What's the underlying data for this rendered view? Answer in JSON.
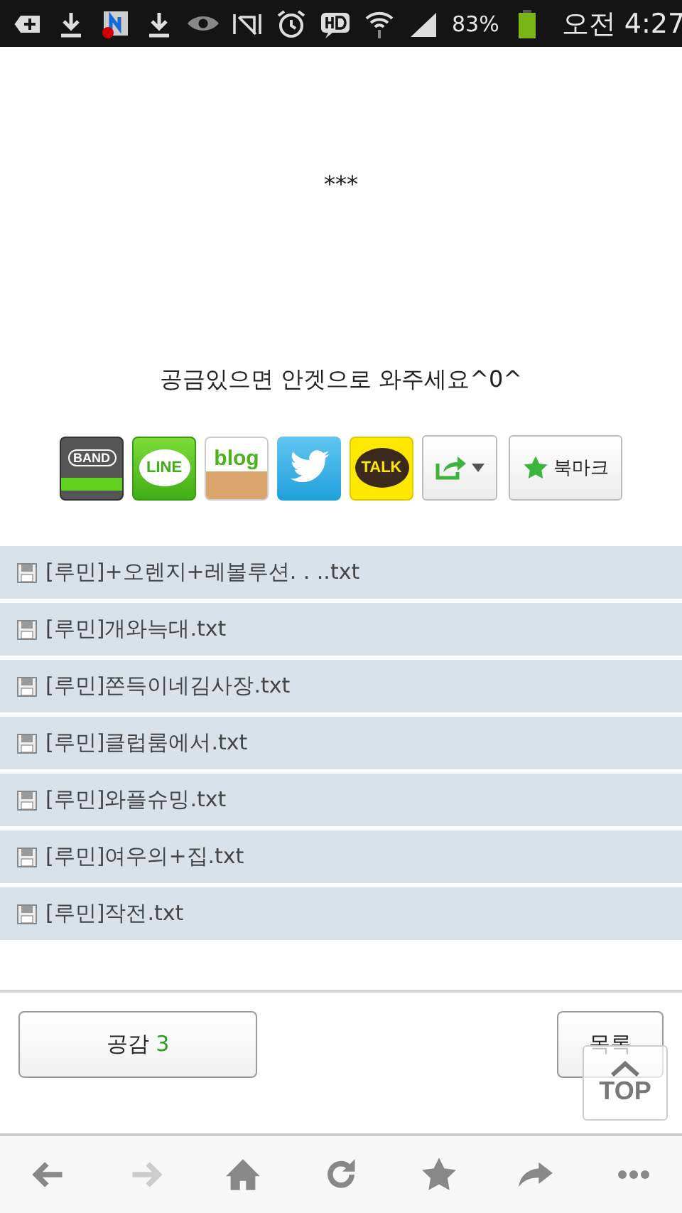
{
  "status_bar": {
    "battery_percent": "83%",
    "time": "오전 4:27"
  },
  "post": {
    "stars": "***",
    "message": "공금있으면 안겟으로 와주세요^0^"
  },
  "share_buttons": [
    {
      "kind": "band",
      "label": "BAND"
    },
    {
      "kind": "line",
      "label": "LINE"
    },
    {
      "kind": "blog",
      "label": "blog"
    },
    {
      "kind": "twitter"
    },
    {
      "kind": "talk",
      "label": "TALK"
    },
    {
      "kind": "share"
    },
    {
      "kind": "bookmark",
      "label": "북마크"
    }
  ],
  "attachments": [
    {
      "name": "[루민]+오렌지+레볼루션. . ..txt"
    },
    {
      "name": "[루민]개와늑대.txt"
    },
    {
      "name": "[루민]쫀득이네김사장.txt"
    },
    {
      "name": "[루민]클럽룸에서.txt"
    },
    {
      "name": "[루민]와플슈밍.txt"
    },
    {
      "name": "[루민]여우의+집.txt"
    },
    {
      "name": "[루민]작전.txt"
    }
  ],
  "actions": {
    "like_label": "공감",
    "like_count": "3",
    "list_label": "목록",
    "top_label": "TOP"
  },
  "browser_nav": [
    {
      "kind": "back",
      "disabled": false
    },
    {
      "kind": "forward",
      "disabled": true
    },
    {
      "kind": "home",
      "disabled": false
    },
    {
      "kind": "reload",
      "disabled": false
    },
    {
      "kind": "bookmark",
      "disabled": false
    },
    {
      "kind": "share",
      "disabled": false
    },
    {
      "kind": "more",
      "disabled": false
    }
  ]
}
